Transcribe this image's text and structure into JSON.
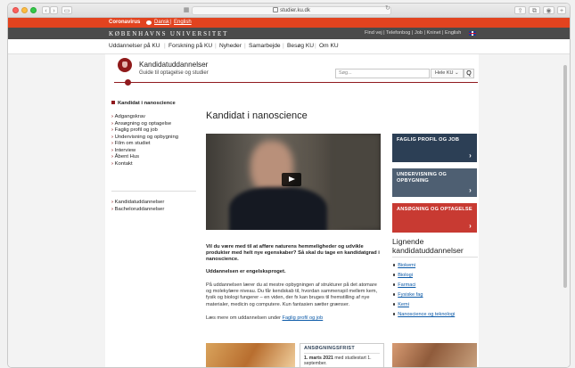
{
  "browser": {
    "url": "studier.ku.dk",
    "nav_back": "‹",
    "nav_fwd": "›",
    "sidebar_btn": "▭",
    "reload": "↻",
    "share": "⇪",
    "tabs_btn": "⧉",
    "extra": "+"
  },
  "covid": {
    "label": "Coronavirus",
    "link_da": "Dansk",
    "separator": "|",
    "link_en": "English"
  },
  "ku": {
    "name": "KØBENHAVNS UNIVERSITET",
    "top_links": "Find vej | Telefonbog | Job | Kninet | English"
  },
  "main_nav": {
    "items": [
      "Uddannelser på KU",
      "Forskning på KU",
      "Nyheder",
      "Samarbejde",
      "Besøg KU",
      "Om KU"
    ],
    "separator": "|"
  },
  "site": {
    "title": "Kandidatuddannelser",
    "subtitle": "Guide til optagelse og studier"
  },
  "search": {
    "placeholder": "Søg...",
    "scope": "Hele KU",
    "button": "Q"
  },
  "sidebar": {
    "heading": "Kandidat i nanoscience",
    "items": [
      "Adgangskrav",
      "Ansøgning og optagelse",
      "Faglig profil og job",
      "Undervisning og opbygning",
      "Film om studiet",
      "Interview",
      "Åbent Hus",
      "Kontakt"
    ],
    "bottom": [
      "Kandidatuddannelser",
      "Bacheloruddannelser"
    ]
  },
  "main": {
    "title": "Kandidat i nanoscience",
    "lead": "Vil du være med til at afføre naturens hemmeligheder og udvikle produkter med helt nye egenskaber? Så skal du tage en kandidatgrad i nanoscience.",
    "language": "Uddannelsen er engelsksproget.",
    "body": "På uddannelsen lærer du at mestre opbygningen af strukturer på det atomare og molekylære niveau. Du får kendskab til, hvordan sammenspil mellem kem, fysik og biologi fungerer – en viden, der fx kan bruges til fremstilling af nye materialer, medicin og computere. Kun fantasien sætter grænser.",
    "more_prefix": "Læs mere om uddannelsen under",
    "more_link": "Faglig profil og job"
  },
  "boxes": [
    {
      "label": "FAGLIG PROFIL OG JOB",
      "arrow": "›"
    },
    {
      "label": "UNDERVISNING OG OPBYGNING",
      "arrow": "›"
    },
    {
      "label": "ANSØGNING OG OPTAGELSE",
      "arrow": "›"
    }
  ],
  "related": {
    "heading": "Lignende kandidatuddannelser",
    "items": [
      "Biokemi",
      "Biologi",
      "Farmaci",
      "Fysiske fag",
      "Kemi",
      "Nanoscience og teknologi"
    ]
  },
  "deadline": {
    "title": "ANSØGNINGSFRIST",
    "date": "1. marts 2021",
    "rest": " med studiestart 1. september."
  },
  "colors": {
    "covid_red": "#e2431f",
    "ku_gray": "#4b4b4b",
    "ku_red": "#901a1e",
    "box_navy": "#2c3f55",
    "box_slate": "#4e5f72",
    "box_red": "#c83a32",
    "link_blue": "#0c5aa8"
  }
}
